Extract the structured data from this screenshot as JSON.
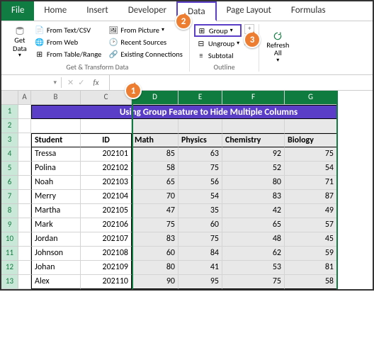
{
  "tabs": {
    "file": "File",
    "home": "Home",
    "insert": "Insert",
    "developer": "Developer",
    "data": "Data",
    "page_layout": "Page Layout",
    "formulas": "Formulas"
  },
  "ribbon": {
    "get_data": "Get\nData",
    "from_text": "From Text/CSV",
    "from_web": "From Web",
    "from_table": "From Table/Range",
    "from_picture": "From Picture",
    "recent": "Recent Sources",
    "existing": "Existing Connections",
    "group": "Group",
    "ungroup": "Ungroup",
    "subtotal": "Subtotal",
    "refresh": "Refresh\nAll",
    "sect1": "Get & Transform Data",
    "sect2": "Outline"
  },
  "callouts": {
    "c1": "1",
    "c2": "2",
    "c3": "3"
  },
  "namebox": "",
  "fx_label": "fx",
  "title": "Using Group Feature to Hide Multiple Columns",
  "headers": {
    "student": "Student",
    "id": "ID",
    "math": "Math",
    "physics": "Physics",
    "chemistry": "Chemistry",
    "biology": "Biology"
  },
  "colhdrs": {
    "A": "A",
    "B": "B",
    "C": "C",
    "D": "D",
    "E": "E",
    "F": "F",
    "G": "G"
  },
  "rows": [
    {
      "student": "Tressa",
      "id": "202101",
      "math": "85",
      "physics": "63",
      "chemistry": "92",
      "biology": "75"
    },
    {
      "student": "Polina",
      "id": "202102",
      "math": "58",
      "physics": "75",
      "chemistry": "52",
      "biology": "54"
    },
    {
      "student": "Noah",
      "id": "202103",
      "math": "65",
      "physics": "56",
      "chemistry": "80",
      "biology": "71"
    },
    {
      "student": "Merry",
      "id": "202104",
      "math": "70",
      "physics": "54",
      "chemistry": "83",
      "biology": "87"
    },
    {
      "student": "Martha",
      "id": "202105",
      "math": "47",
      "physics": "35",
      "chemistry": "42",
      "biology": "49"
    },
    {
      "student": "Mark",
      "id": "202106",
      "math": "75",
      "physics": "60",
      "chemistry": "65",
      "biology": "57"
    },
    {
      "student": "Jordan",
      "id": "202107",
      "math": "83",
      "physics": "75",
      "chemistry": "48",
      "biology": "45"
    },
    {
      "student": "Johnson",
      "id": "202108",
      "math": "60",
      "physics": "84",
      "chemistry": "62",
      "biology": "59"
    },
    {
      "student": "Johan",
      "id": "202109",
      "math": "80",
      "physics": "41",
      "chemistry": "53",
      "biology": "81"
    },
    {
      "student": "Alex",
      "id": "202110",
      "math": "90",
      "physics": "95",
      "chemistry": "75",
      "biology": "58"
    }
  ]
}
